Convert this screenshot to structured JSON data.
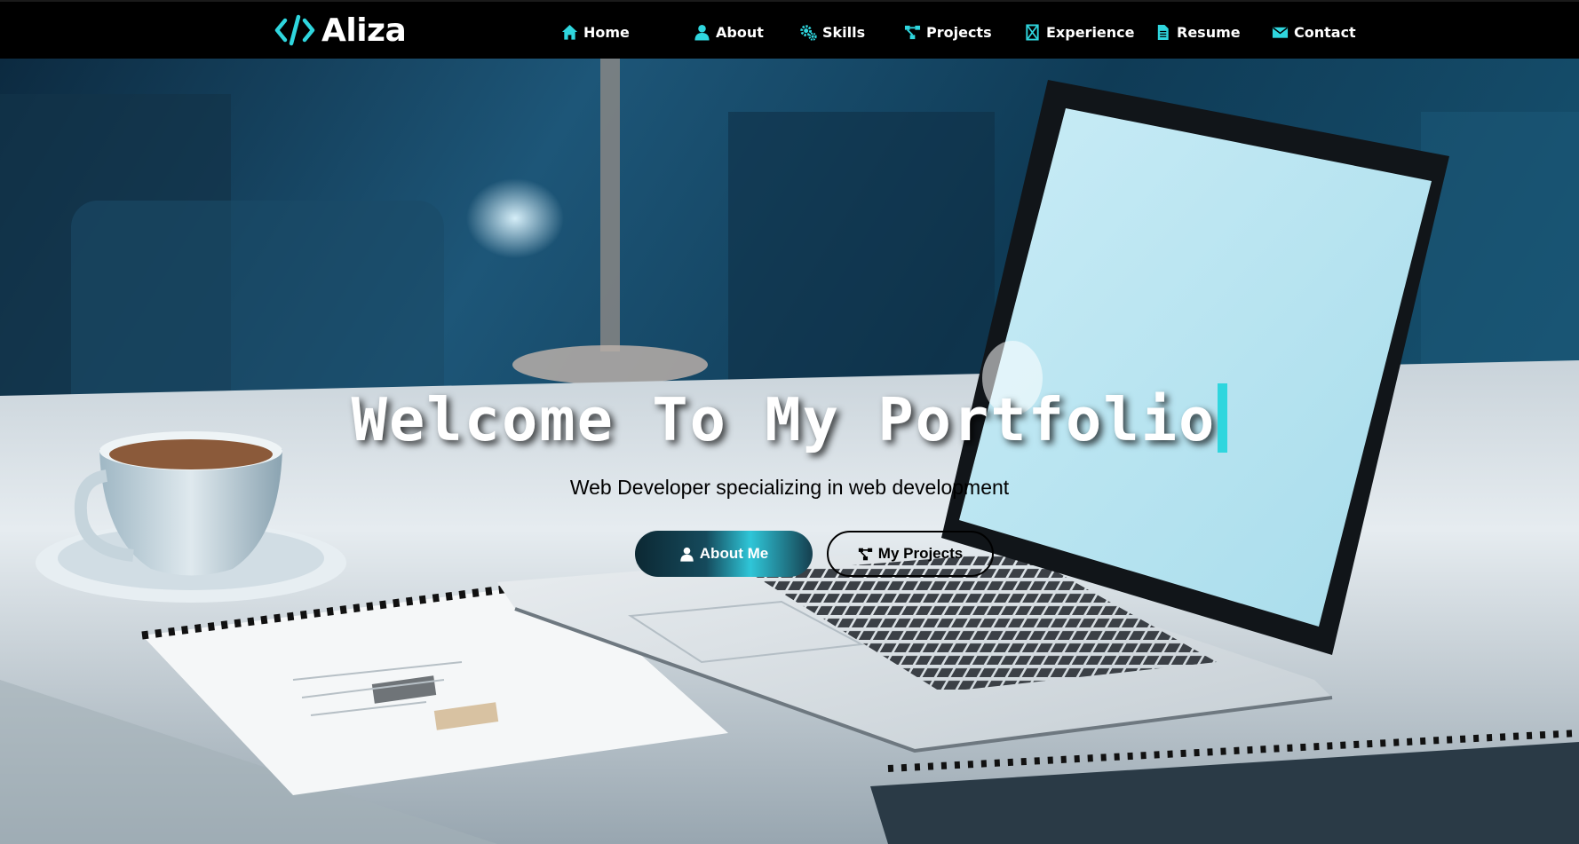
{
  "brand": {
    "name": "Aliza",
    "logo_icon": "code-brackets-icon",
    "accent_color": "#2fd6de"
  },
  "nav": {
    "items": [
      {
        "label": "Home",
        "icon": "home-icon"
      },
      {
        "label": "About",
        "icon": "user-icon"
      },
      {
        "label": "Skills",
        "icon": "gears-icon"
      },
      {
        "label": "Projects",
        "icon": "project-diagram-icon"
      },
      {
        "label": "Experience",
        "icon": "hourglass-icon"
      },
      {
        "label": "Resume",
        "icon": "file-icon"
      },
      {
        "label": "Contact",
        "icon": "envelope-icon"
      }
    ]
  },
  "hero": {
    "title": "Welcome To My Portfolio",
    "subtitle": "Web Developer specializing in web development",
    "buttons": {
      "primary": {
        "label": "About Me",
        "icon": "user-icon"
      },
      "secondary": {
        "label": "My Projects",
        "icon": "project-diagram-icon"
      }
    }
  },
  "colors": {
    "navbar_bg": "#000000",
    "accent": "#2fd6de",
    "text_light": "#ffffff",
    "text_dark": "#000000"
  }
}
